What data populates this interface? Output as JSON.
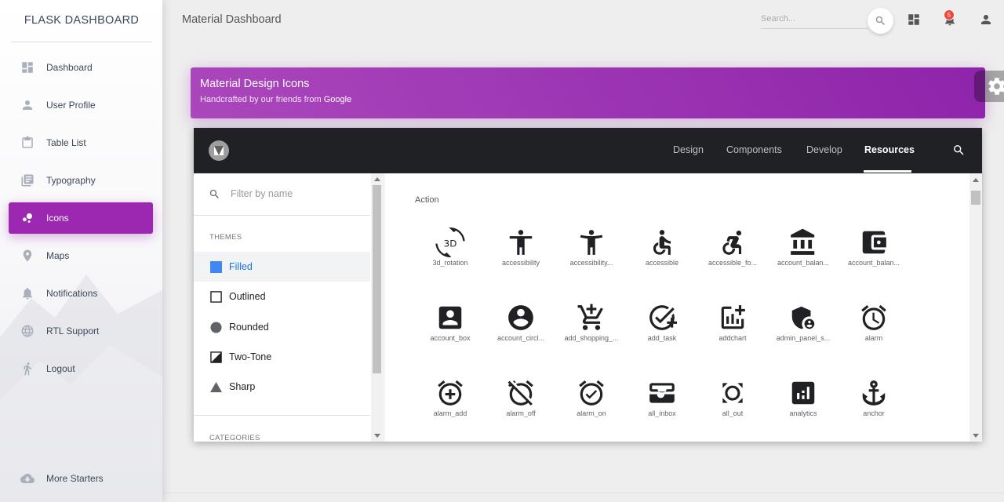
{
  "sidebar": {
    "brand": "FLASK DASHBOARD",
    "items": [
      {
        "label": "Dashboard",
        "icon": "dashboard-icon"
      },
      {
        "label": "User Profile",
        "icon": "person-icon"
      },
      {
        "label": "Table List",
        "icon": "clipboard-icon"
      },
      {
        "label": "Typography",
        "icon": "library-books-icon"
      },
      {
        "label": "Icons",
        "icon": "bubble-chart-icon",
        "active": true
      },
      {
        "label": "Maps",
        "icon": "location-pin-icon"
      },
      {
        "label": "Notifications",
        "icon": "bell-icon"
      },
      {
        "label": "RTL Support",
        "icon": "language-icon"
      },
      {
        "label": "Logout",
        "icon": "run-icon"
      }
    ],
    "bottom_item": {
      "label": "More Starters",
      "icon": "cloud-download-icon"
    }
  },
  "topbar": {
    "title": "Material Dashboard",
    "search_placeholder": "Search...",
    "notification_count": "5"
  },
  "card": {
    "title": "Material Design Icons",
    "subtitle_prefix": "Handcrafted by our friends from ",
    "subtitle_link": "Google"
  },
  "material_site": {
    "nav": [
      "Design",
      "Components",
      "Develop",
      "Resources"
    ],
    "active_nav": "Resources",
    "filter_placeholder": "Filter by name",
    "themes_label": "THEMES",
    "themes": [
      "Filled",
      "Outlined",
      "Rounded",
      "Two-Tone",
      "Sharp"
    ],
    "selected_theme": "Filled",
    "categories_label": "CATEGORIES",
    "section": "Action",
    "icons": [
      "3d_rotation",
      "accessibility",
      "accessibility...",
      "accessible",
      "accessible_fo...",
      "account_balan...",
      "account_balan...",
      "account_box",
      "account_circl...",
      "add_shopping_...",
      "add_task",
      "addchart",
      "admin_panel_s...",
      "alarm",
      "alarm_add",
      "alarm_off",
      "alarm_on",
      "all_inbox",
      "all_out",
      "analytics",
      "anchor"
    ]
  },
  "colors": {
    "accent": "#9c27b0",
    "badge": "#f44336",
    "selected_theme": "#1a73e8",
    "site_nav_bg": "#202124"
  }
}
